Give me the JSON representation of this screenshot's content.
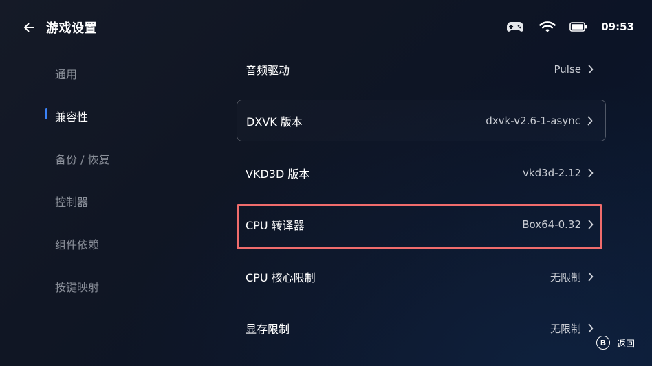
{
  "header": {
    "title": "游戏设置",
    "back_icon": "arrow-left-icon"
  },
  "status_bar": {
    "icons": [
      "gamepad-icon",
      "wifi-icon",
      "battery-icon"
    ],
    "time": "09:53"
  },
  "sidebar": {
    "items": [
      {
        "label": "通用",
        "active": false
      },
      {
        "label": "兼容性",
        "active": true
      },
      {
        "label": "备份 / 恢复",
        "active": false
      },
      {
        "label": "控制器",
        "active": false
      },
      {
        "label": "组件依赖",
        "active": false
      },
      {
        "label": "按键映射",
        "active": false
      }
    ]
  },
  "settings": [
    {
      "label": "音频驱动",
      "value": "Pulse"
    },
    {
      "label": "DXVK 版本",
      "value": "dxvk-v2.6-1-async",
      "focused": true
    },
    {
      "label": "VKD3D 版本",
      "value": "vkd3d-2.12"
    },
    {
      "label": "CPU 转译器",
      "value": "Box64-0.32",
      "highlighted": true
    },
    {
      "label": "CPU 核心限制",
      "value": "无限制"
    },
    {
      "label": "显存限制",
      "value": "无限制"
    }
  ],
  "footer_hint": {
    "button": "B",
    "label": "返回"
  },
  "colors": {
    "accent": "#3b82f6",
    "highlight": "#f06c6c",
    "inactive_text": "#8a8f99"
  }
}
